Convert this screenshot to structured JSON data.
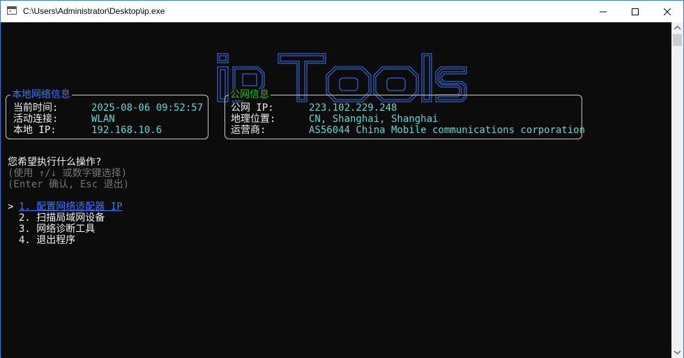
{
  "window": {
    "title": "C:\\Users\\Administrator\\Desktop\\ip.exe"
  },
  "banner": {
    "text": "ipTools"
  },
  "local_info": {
    "legend": "本地网络信息",
    "rows": [
      {
        "label": "当前时间:",
        "value": "2025-08-06 09:52:57"
      },
      {
        "label": "活动连接:",
        "value": "WLAN"
      },
      {
        "label": "本地 IP:",
        "value": "192.168.10.6"
      }
    ]
  },
  "public_info": {
    "legend": "公网信息",
    "rows": [
      {
        "label": "公网 IP:",
        "value": "223.102.229.248"
      },
      {
        "label": "地理位置:",
        "value": "CN, Shanghai, Shanghai"
      },
      {
        "label": "运营商:",
        "value": "AS56044 China Mobile communications corporation"
      }
    ]
  },
  "prompt": {
    "question": "您希望执行什么操作?",
    "hint1": "(使用 ↑/↓ 或数字键选择)",
    "hint2": "(Enter 确认, Esc 退出)"
  },
  "menu": {
    "cursor": ">",
    "items": [
      {
        "label": "1. 配置网络适配器 IP"
      },
      {
        "label": "2. 扫描局域网设备"
      },
      {
        "label": "3. 网络诊断工具"
      },
      {
        "label": "4. 退出程序"
      }
    ]
  },
  "colors": {
    "accent": "#3b78ff",
    "value": "#61d6d6",
    "public_legend": "#16c60c",
    "hint": "#767676",
    "text": "#f2f2f2"
  },
  "icons": [
    "console-app-icon",
    "minimize-icon",
    "maximize-icon",
    "close-icon",
    "scroll-up-icon",
    "scroll-down-icon"
  ]
}
